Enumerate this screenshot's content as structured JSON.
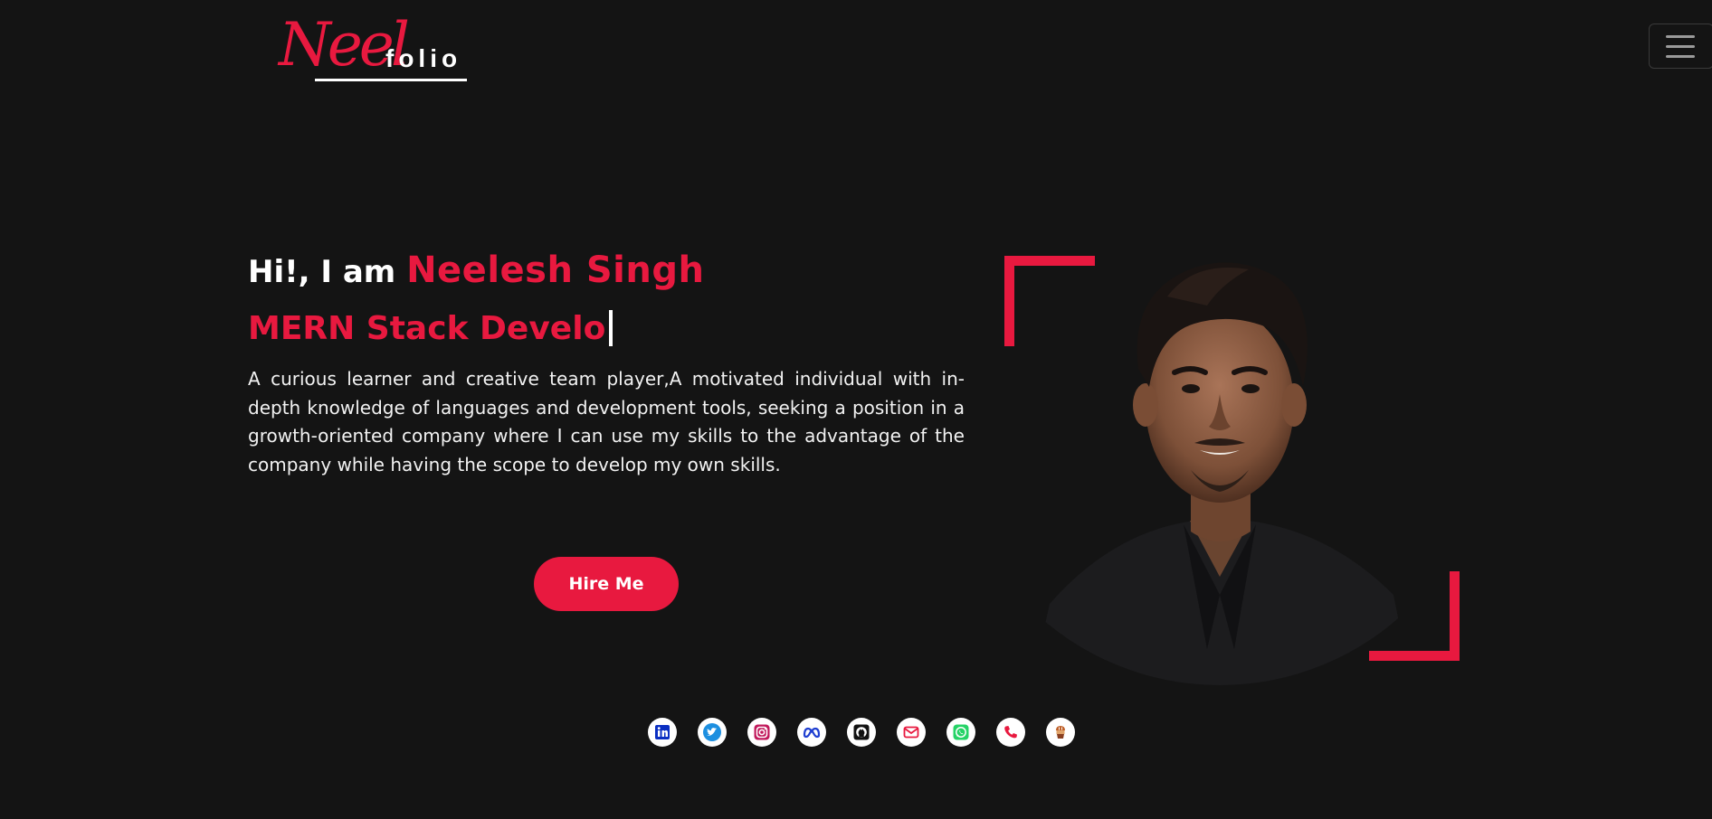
{
  "header": {
    "logo_script": "Neel",
    "logo_suffix": "folio",
    "menu_icon": "hamburger-menu-icon"
  },
  "hero": {
    "greeting_prefix": "Hi!, I am",
    "name": "Neelesh Singh",
    "role_typed": "MERN Stack Develo",
    "intro": "A curious learner and creative team player,A motivated individual with in-depth knowledge of languages and development tools, seeking a position in a growth-oriented company where I can use my skills to the advantage of the company while having the scope to develop my own skills.",
    "hire_label": "Hire Me"
  },
  "portrait": {
    "icon": "profile-photo"
  },
  "socials": [
    {
      "icon": "linkedin-icon",
      "color": "#0a66c2"
    },
    {
      "icon": "twitter-icon",
      "color": "#1d9bf0"
    },
    {
      "icon": "instagram-icon",
      "color": "#d62976"
    },
    {
      "icon": "meta-icon",
      "color": "#1f3fd1"
    },
    {
      "icon": "github-icon",
      "color": "#111111"
    },
    {
      "icon": "email-icon",
      "color": "#e8193f"
    },
    {
      "icon": "whatsapp-icon",
      "color": "#25d366"
    },
    {
      "icon": "phone-icon",
      "color": "#e8193f"
    },
    {
      "icon": "hackerrank-icon",
      "color": "#c0622b"
    }
  ],
  "colors": {
    "background": "#141414",
    "accent": "#e8193f",
    "text": "#f2f2f2"
  }
}
